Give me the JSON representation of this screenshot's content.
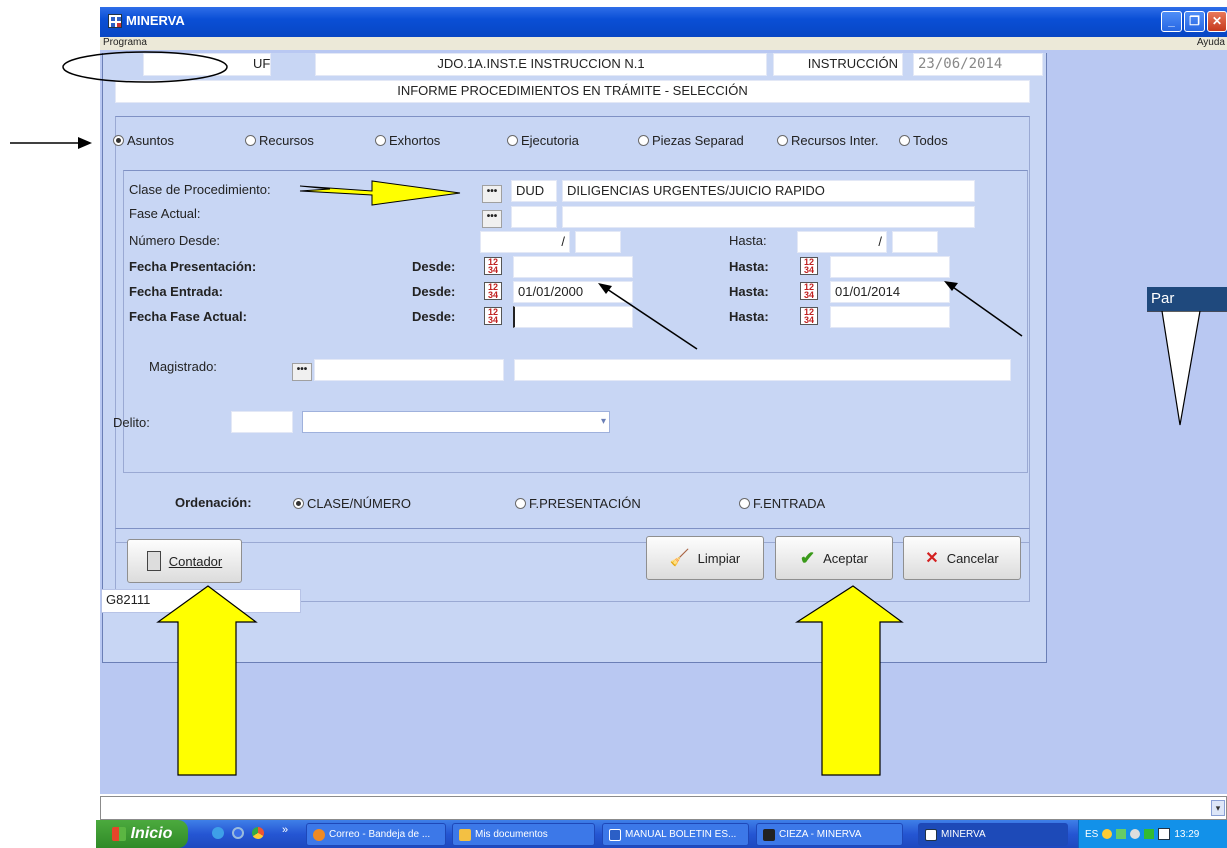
{
  "window": {
    "title": "MINERVA",
    "min_label": "_",
    "max_label": "❐",
    "close_label": "✕"
  },
  "menu": {
    "programa": "Programa",
    "ayuda": "Ayuda"
  },
  "header": {
    "org_code": "UFT",
    "court": "JDO.1A.INST.E INSTRUCCION N.1",
    "type": "INSTRUCCIÓN",
    "date": "23/06/2014",
    "report_title": "INFORME PROCEDIMIENTOS EN TRÁMITE - SELECCIÓN"
  },
  "scope_options": [
    {
      "label": "Asuntos",
      "selected": true
    },
    {
      "label": "Recursos",
      "selected": false
    },
    {
      "label": "Exhortos",
      "selected": false
    },
    {
      "label": "Ejecutoria",
      "selected": false
    },
    {
      "label": "Piezas Separad",
      "selected": false
    },
    {
      "label": "Recursos Inter.",
      "selected": false
    },
    {
      "label": "Todos",
      "selected": false
    }
  ],
  "filters": {
    "clase_label": "Clase de Procedimiento:",
    "clase_code": "DUD",
    "clase_desc": "DILIGENCIAS URGENTES/JUICIO RAPIDO",
    "fase_label": "Fase Actual:",
    "numero_label": "Número Desde:",
    "slash": "/",
    "hasta_plain": "Hasta:",
    "desde": "Desde:",
    "hasta": "Hasta:",
    "fecha_presentacion": "Fecha Presentación:",
    "fecha_entrada": "Fecha Entrada:",
    "fecha_entrada_desde": "01/01/2000",
    "fecha_entrada_hasta": "01/01/2014",
    "fecha_fase": "Fecha Fase Actual:",
    "magistrado_label": "Magistrado:",
    "delito_label": "Delito:",
    "dots": "•••",
    "cal": "1|2\n3|4"
  },
  "ordering": {
    "label": "Ordenación:",
    "options": [
      {
        "label": "CLASE/NÚMERO",
        "selected": true
      },
      {
        "label": "F.PRESENTACIÓN",
        "selected": false
      },
      {
        "label": "F.ENTRADA",
        "selected": false
      }
    ]
  },
  "buttons": {
    "contador": "Contador",
    "limpiar": "Limpiar",
    "aceptar": "Aceptar",
    "cancelar": "Cancelar"
  },
  "status_code": "G82111",
  "annotation": {
    "callout_text": "Par"
  },
  "taskbar": {
    "start": "Inicio",
    "chevron": "»",
    "tasks": [
      "Correo - Bandeja de ...",
      "Mis documentos",
      "MANUAL BOLETIN ES...",
      "CIEZA - MINERVA",
      "MINERVA"
    ],
    "lang": "ES",
    "clock": "13:29"
  },
  "colors": {
    "titlebar": "#0a4fd6",
    "form_bg": "#c8d6f4",
    "client_bg": "#b9c8f2",
    "arrow_yellow": "#ffff00"
  }
}
